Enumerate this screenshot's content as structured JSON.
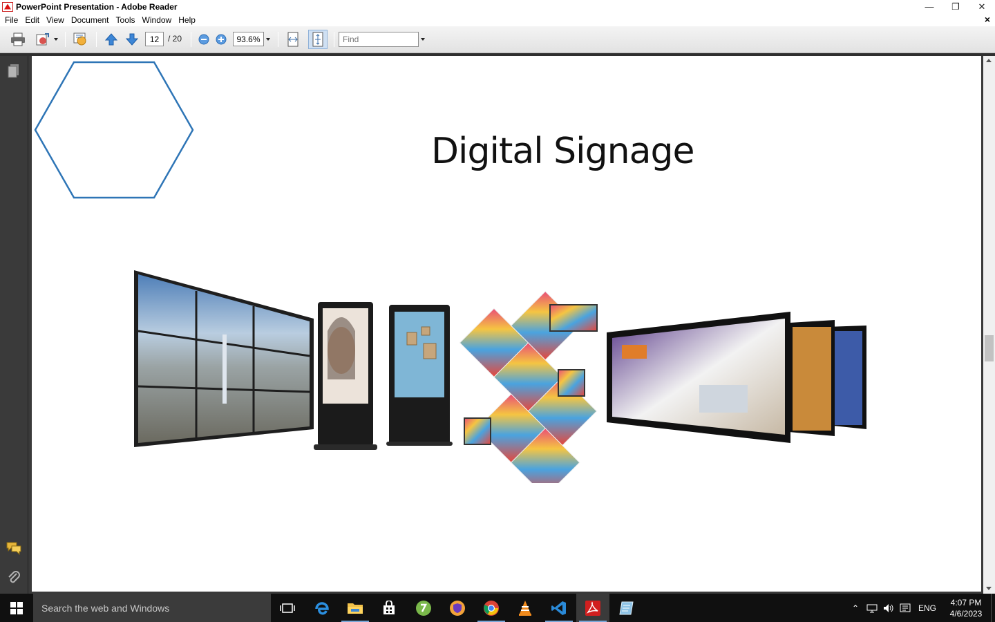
{
  "window": {
    "title": "PowerPoint Presentation - Adobe Reader",
    "controls": [
      "minimize",
      "restore",
      "close"
    ]
  },
  "menu": {
    "items": [
      "File",
      "Edit",
      "View",
      "Document",
      "Tools",
      "Window",
      "Help"
    ],
    "doc_close": "×"
  },
  "toolbar": {
    "current_page": "12",
    "page_total": "/ 20",
    "zoom": "93.6%",
    "find_placeholder": "Find"
  },
  "slide": {
    "title": "Digital Signage"
  },
  "taskbar": {
    "search_placeholder": "Search the web and Windows",
    "language": "ENG",
    "time": "4:07 PM",
    "date": "4/6/2023"
  },
  "colors": {
    "hexagon_stroke": "#2e75b6",
    "acrobat_red": "#d11f1f",
    "taskbar_bg": "#101010"
  }
}
